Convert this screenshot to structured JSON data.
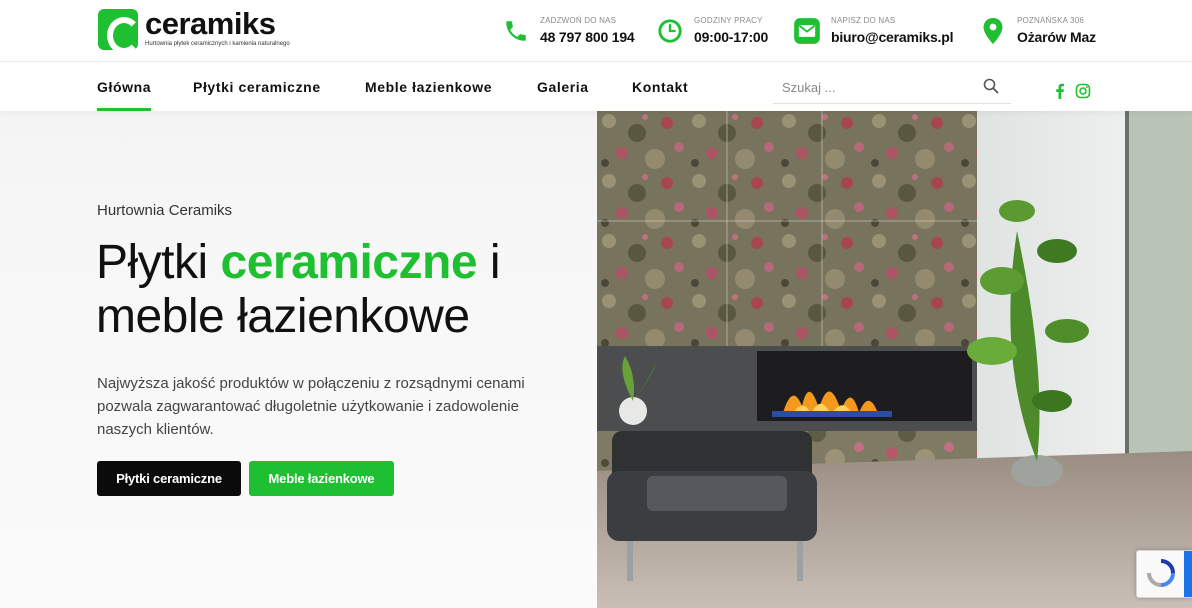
{
  "brand": {
    "name": "ceramiks",
    "tagline": "Hurtownia płytek ceramicznych i kamienia naturalnego",
    "accent": "#1fbf32"
  },
  "contacts": [
    {
      "icon": "phone-icon",
      "label": "ZADZWOŃ DO NAS",
      "value": "48 797 800 194"
    },
    {
      "icon": "clock-icon",
      "label": "GODZINY PRACY",
      "value": "09:00-17:00"
    },
    {
      "icon": "envelope-icon",
      "label": "NAPISZ DO NAS",
      "value": "biuro@ceramiks.pl"
    },
    {
      "icon": "map-pin-icon",
      "label": "POZNAŃSKA 306",
      "value": "Ożarów Maz"
    }
  ],
  "nav": {
    "items": [
      {
        "label": "Główna",
        "active": true
      },
      {
        "label": "Płytki ceramiczne",
        "active": false
      },
      {
        "label": "Meble łazienkowe",
        "active": false
      },
      {
        "label": "Galeria",
        "active": false
      },
      {
        "label": "Kontakt",
        "active": false
      }
    ],
    "search_placeholder": "Szukaj ...",
    "social": [
      "facebook-icon",
      "instagram-icon"
    ]
  },
  "hero": {
    "eyebrow": "Hurtownia Ceramiks",
    "headline_pre": "Płytki ",
    "headline_accent": "ceramiczne",
    "headline_post": " i meble łazienkowe",
    "lead": "Najwyższa jakość produktów w połączeniu z rozsądnymi cenami pozwala zagwarantować długoletnie użytkowanie i zadowolenie naszych klientów.",
    "buttons": [
      {
        "label": "Płytki ceramiczne",
        "style": "dark"
      },
      {
        "label": "Meble łazienkowe",
        "style": "green"
      }
    ]
  }
}
